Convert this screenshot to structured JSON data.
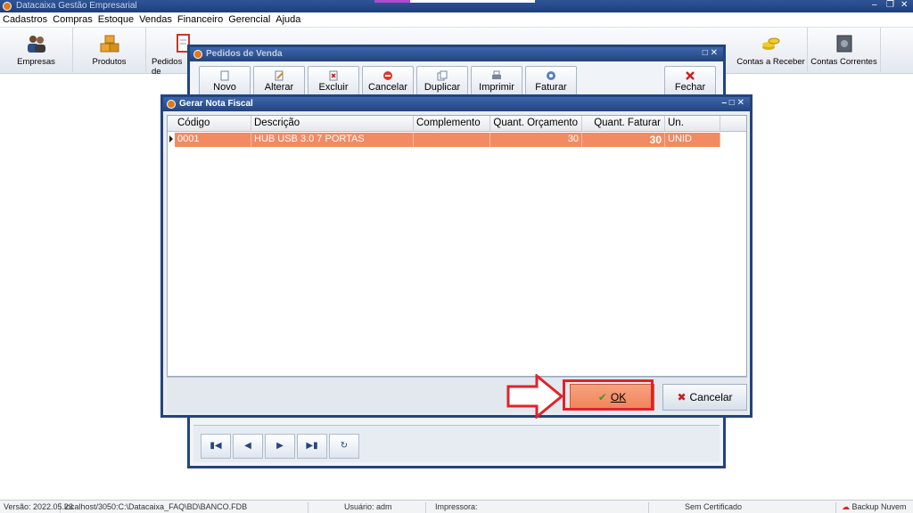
{
  "app": {
    "title": "Datacaixa Gestão Empresarial",
    "menu": [
      "Cadastros",
      "Compras",
      "Estoque",
      "Vendas",
      "Financeiro",
      "Gerencial",
      "Ajuda"
    ]
  },
  "toolbar": {
    "items": [
      {
        "label": "Empresas",
        "icon": "users-icon"
      },
      {
        "label": "Produtos",
        "icon": "boxes-icon"
      },
      {
        "label": "Pedidos de",
        "icon": "order-icon"
      },
      {
        "label": "Contas a Receber",
        "icon": "coins-icon"
      },
      {
        "label": "Contas Correntes",
        "icon": "safe-icon"
      }
    ]
  },
  "pedidos": {
    "title": "Pedidos de Venda",
    "buttons": [
      "Novo",
      "Alterar",
      "Excluir",
      "Cancelar",
      "Duplicar",
      "Imprimir",
      "Faturar",
      "Fechar"
    ]
  },
  "nf": {
    "title": "Gerar Nota Fiscal",
    "columns": [
      "Código",
      "Descrição",
      "Complemento",
      "Quant. Orçamento",
      "Quant. Faturar",
      "Un."
    ],
    "rows": [
      {
        "codigo": "0001",
        "descricao": "HUB USB 3.0 7 PORTAS",
        "complemento": "",
        "quant_orcamento": "30",
        "quant_faturar": "30",
        "un": "UNID"
      }
    ],
    "ok_label": "OK",
    "cancel_label": "Cancelar"
  },
  "status": {
    "versao": "Versão: 2022.05.23",
    "banco": "localhost/3050:C:\\Datacaixa_FAQ\\BD\\BANCO.FDB",
    "usuario": "Usuário: adm",
    "impressora": "Impressora:",
    "certificado": "Sem Certificado",
    "backup": "Backup Nuvem"
  },
  "colors": {
    "title_bar": "#23447e",
    "selected_row": "#f28b63",
    "highlight": "#e0232a"
  }
}
